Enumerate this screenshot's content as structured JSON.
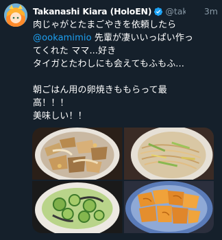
{
  "tweet": {
    "author_name": "Takanashi Kiara (HoloEN)",
    "handle": "@tak...",
    "time": "3m",
    "mention": "@ookamimio",
    "lines": {
      "l1": "肉じゃがとたまごやきを依頼したら",
      "l2_rest": " 先輩が凄いいっぱい作っ",
      "l3": "てくれた ママ...好き",
      "l4": "タイガとたわしにも会えてもふもふ...",
      "l5": "朝ごはん用の卵焼きももらって最",
      "l6": "高！！！",
      "l7": "美味しい！！"
    }
  },
  "icons": {
    "verified": "verified-badge-icon"
  },
  "colors": {
    "background": "#15202b",
    "text": "#ffffff",
    "secondary": "#8899a6",
    "link": "#1da1f2"
  }
}
